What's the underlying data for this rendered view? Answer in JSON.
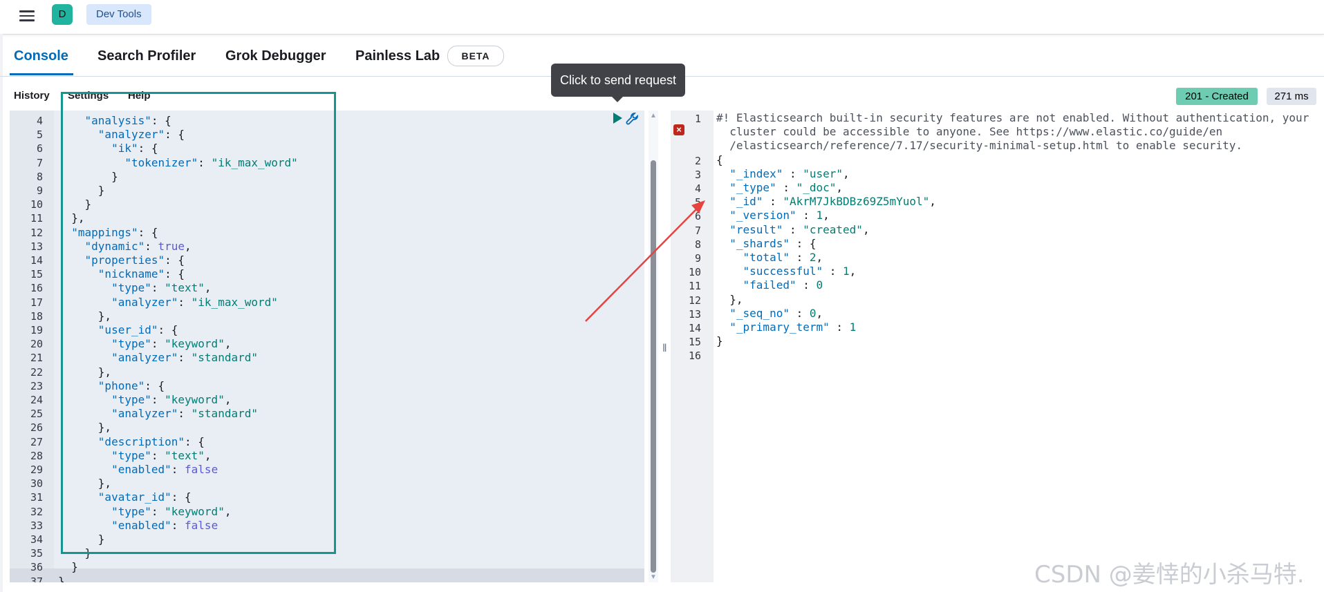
{
  "header": {
    "avatar_letter": "D",
    "breadcrumb": "Dev Tools",
    "menu_icon": "hamburger-menu-icon"
  },
  "tabs": [
    {
      "label": "Console",
      "active": true
    },
    {
      "label": "Search Profiler",
      "active": false
    },
    {
      "label": "Grok Debugger",
      "active": false
    },
    {
      "label": "Painless Lab",
      "active": false
    }
  ],
  "beta_badge": "BETA",
  "tooltip": "Click to send request",
  "console_links": {
    "history": "History",
    "settings": "Settings",
    "help": "Help"
  },
  "response_status": {
    "status": "201 - Created",
    "time": "271 ms",
    "status_color": "#6dccb1"
  },
  "request_editor": {
    "line_numbers": [
      "4",
      "5",
      "6",
      "7",
      "8",
      "9",
      "10",
      "11",
      "12",
      "13",
      "14",
      "15",
      "16",
      "17",
      "18",
      "19",
      "20",
      "21",
      "22",
      "23",
      "24",
      "25",
      "26",
      "27",
      "28",
      "29",
      "30",
      "31",
      "32",
      "33",
      "34",
      "35",
      "36",
      "37"
    ],
    "lines": [
      "    \"analysis\": {",
      "      \"analyzer\": {",
      "        \"ik\": {",
      "          \"tokenizer\": \"ik_max_word\"",
      "        }",
      "      }",
      "    }",
      "  },",
      "  \"mappings\": {",
      "    \"dynamic\": true,",
      "    \"properties\": {",
      "      \"nickname\": {",
      "        \"type\": \"text\",",
      "        \"analyzer\": \"ik_max_word\"",
      "      },",
      "      \"user_id\": {",
      "        \"type\": \"keyword\",",
      "        \"analyzer\": \"standard\"",
      "      },",
      "      \"phone\": {",
      "        \"type\": \"keyword\",",
      "        \"analyzer\": \"standard\"",
      "      },",
      "      \"description\": {",
      "        \"type\": \"text\",",
      "        \"enabled\": false",
      "      },",
      "      \"avatar_id\": {",
      "        \"type\": \"keyword\",",
      "        \"enabled\": false",
      "      }",
      "    }",
      "  }",
      "}"
    ]
  },
  "response_output": {
    "line_numbers": [
      "1",
      "",
      "",
      "2",
      "3",
      "4",
      "5",
      "6",
      "7",
      "8",
      "9",
      "10",
      "11",
      "12",
      "13",
      "14",
      "15",
      "16"
    ],
    "lines": [
      "#! Elasticsearch built-in security features are not enabled. Without authentication, your",
      "  cluster could be accessible to anyone. See https://www.elastic.co/guide/en",
      "  /elasticsearch/reference/7.17/security-minimal-setup.html to enable security.",
      "{",
      "  \"_index\" : \"user\",",
      "  \"_type\" : \"_doc\",",
      "  \"_id\" : \"AkrM7JkBDBz69Z5mYuol\",",
      "  \"_version\" : 1,",
      "  \"result\" : \"created\",",
      "  \"_shards\" : {",
      "    \"total\" : 2,",
      "    \"successful\" : 1,",
      "    \"failed\" : 0",
      "  },",
      "  \"_seq_no\" : 0,",
      "  \"_primary_term\" : 1",
      "}",
      ""
    ]
  },
  "watermark": "CSDN @姜悻的小杀马特.",
  "colors": {
    "accent": "#006bb8",
    "annotation_box": "#14958e",
    "annotation_arrow": "#e8423f"
  }
}
